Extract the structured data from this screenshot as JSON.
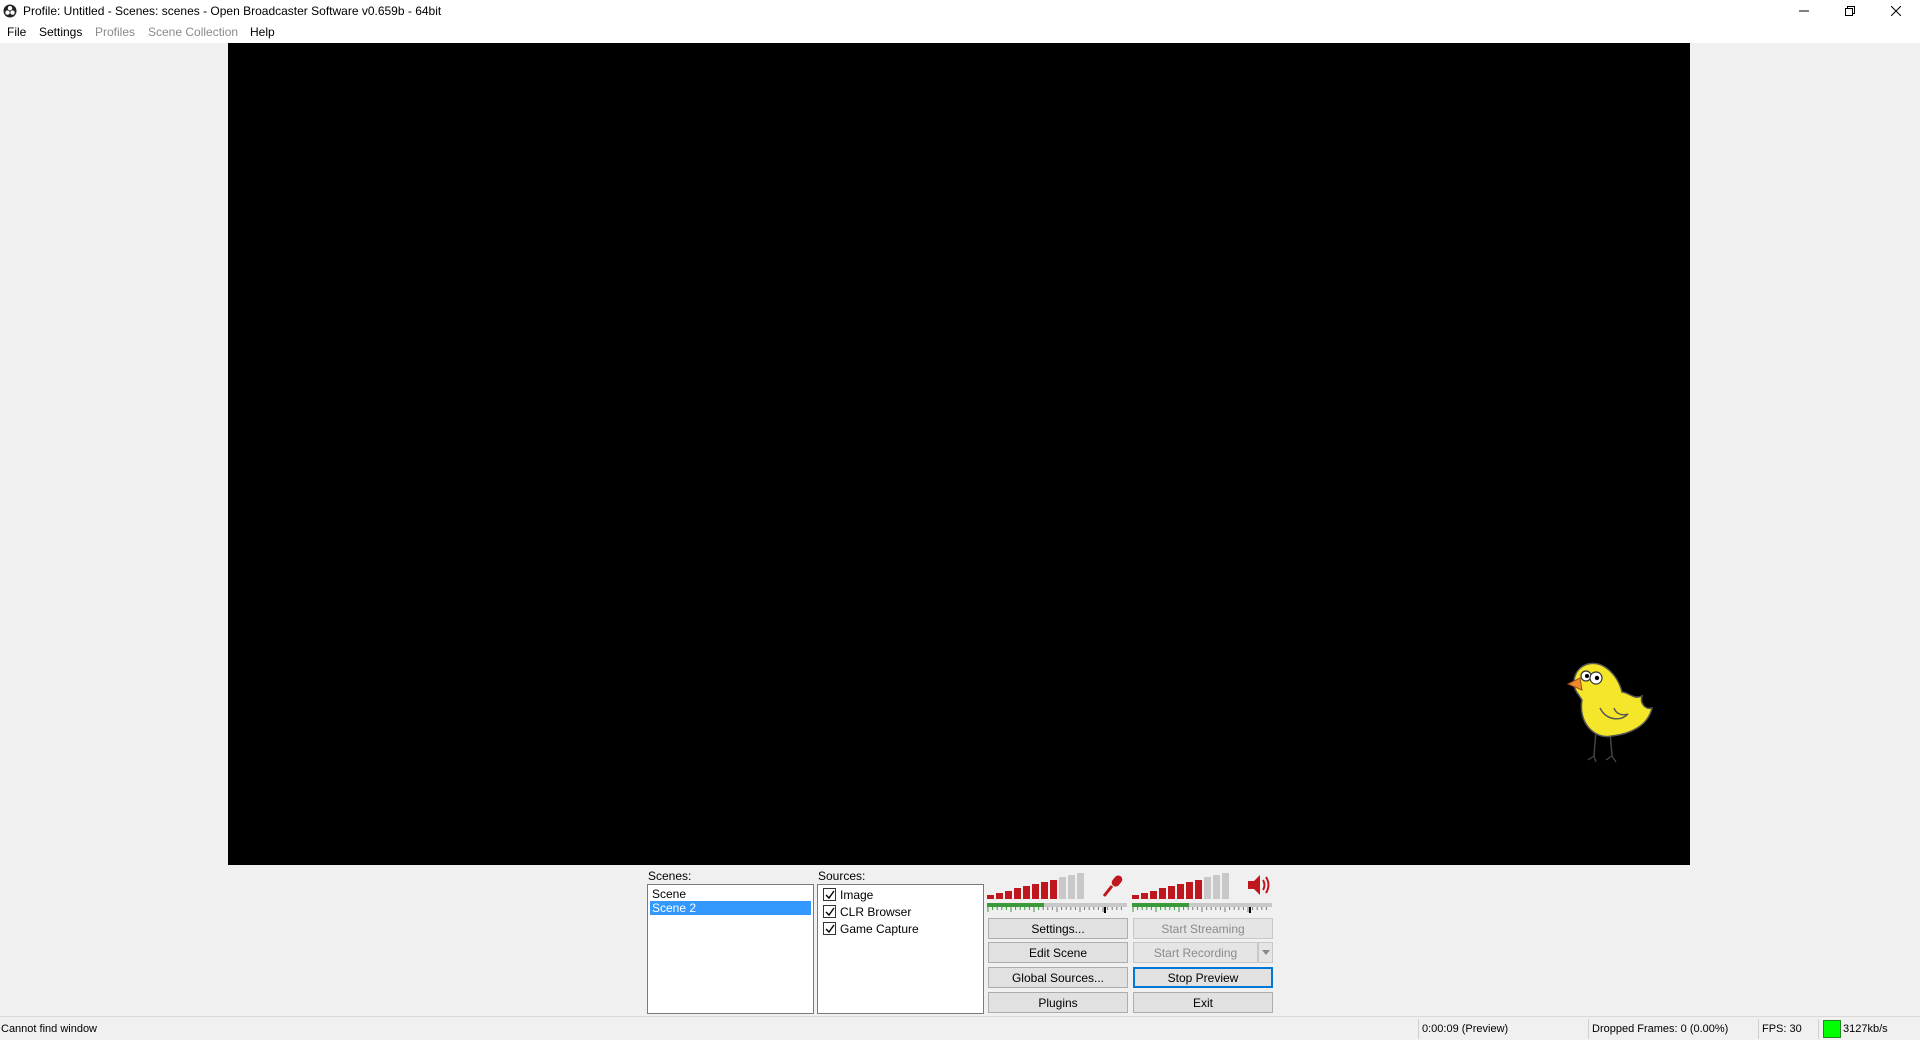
{
  "window": {
    "title": "Profile: Untitled - Scenes: scenes - Open Broadcaster Software v0.659b - 64bit",
    "icon": "obs-logo-icon"
  },
  "menu": {
    "file": "File",
    "settings": "Settings",
    "profiles": "Profiles",
    "scene_collection": "Scene Collection",
    "help": "Help"
  },
  "scenes": {
    "label": "Scenes:",
    "items": [
      "Scene",
      "Scene 2"
    ],
    "selected": "Scene 2"
  },
  "sources": {
    "label": "Sources:",
    "items": [
      {
        "label": "Image",
        "checked": true
      },
      {
        "label": "CLR Browser",
        "checked": true
      },
      {
        "label": "Game Capture",
        "checked": true
      }
    ]
  },
  "audio": {
    "mic_icon": "microphone-icon",
    "speaker_icon": "speaker-icon",
    "mic_level": 0.45,
    "desktop_level": 0.45,
    "active_color": "#c0161d",
    "inactive_color": "#c8c8c8"
  },
  "buttons": {
    "settings": "Settings...",
    "start_streaming": "Start Streaming",
    "edit_scene": "Edit Scene",
    "start_recording": "Start Recording",
    "global_sources": "Global Sources...",
    "stop_preview": "Stop Preview",
    "plugins": "Plugins",
    "exit": "Exit"
  },
  "status": {
    "message": "Cannot find window",
    "time": "0:00:09 (Preview)",
    "dropped_frames": "Dropped Frames: 0 (0.00%)",
    "fps": "FPS: 30",
    "bitrate": "3127kb/s",
    "bitrate_color": "#00ff00"
  },
  "preview": {
    "background": "#000000",
    "overlay_image": "yellow-chick-image"
  }
}
